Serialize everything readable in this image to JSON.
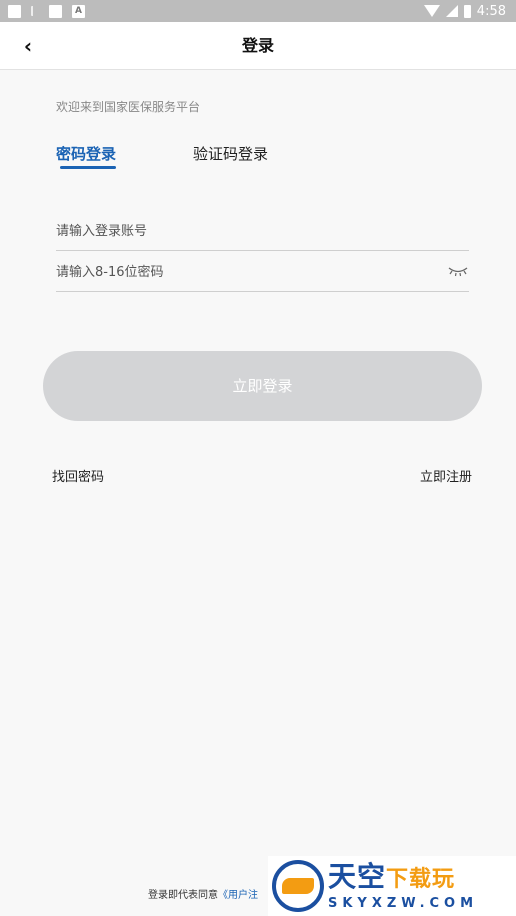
{
  "status_bar": {
    "time": "4:58"
  },
  "header": {
    "title": "登录"
  },
  "welcome": "欢迎来到国家医保服务平台",
  "tabs": [
    {
      "label": "密码登录",
      "active": true
    },
    {
      "label": "验证码登录",
      "active": false
    }
  ],
  "form": {
    "account_placeholder": "请输入登录账号",
    "password_placeholder": "请输入8-16位密码"
  },
  "login_button": "立即登录",
  "links": {
    "forgot": "找回密码",
    "register": "立即注册"
  },
  "agreement": {
    "prefix": "登录即代表同意",
    "link": "《用户注"
  },
  "watermark": {
    "title_blue": "天空",
    "title_orange": "下载玩",
    "subtitle": "SKYXZW.COM"
  },
  "colors": {
    "accent": "#1b63b4",
    "button_disabled": "#d3d4d6",
    "background": "#f8f8f8"
  }
}
